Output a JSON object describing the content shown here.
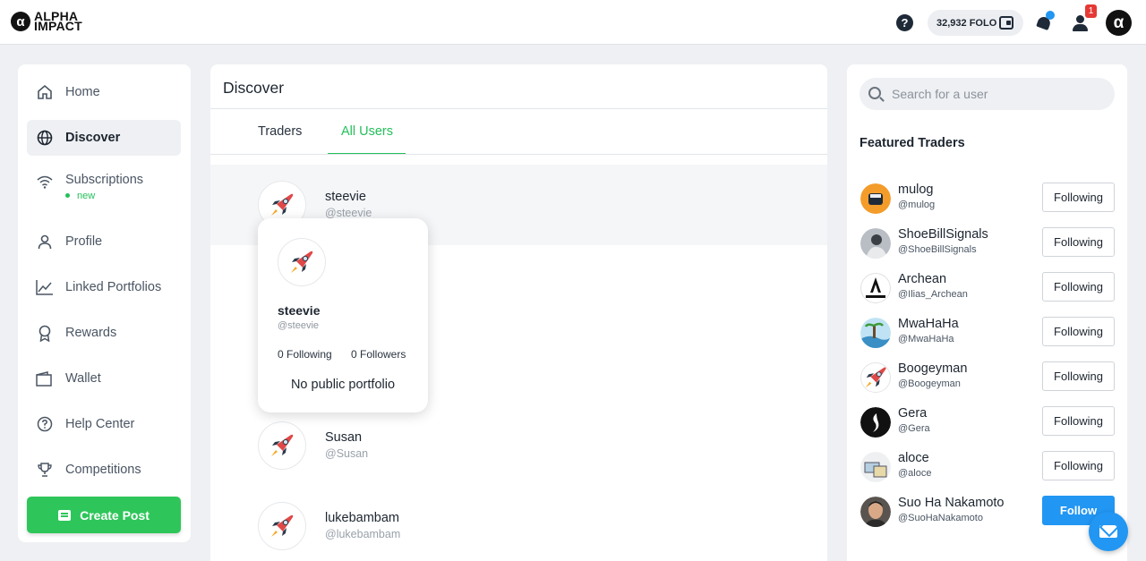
{
  "brand": {
    "name_line1": "ALPHA",
    "name_line2": "IMPACT",
    "mark": "α"
  },
  "header": {
    "help_icon": "question-circle-icon",
    "balance": "32,932 FOLO",
    "notification_badge": "1",
    "account_mark": "α"
  },
  "sidebar": {
    "items": [
      {
        "label": "Home",
        "icon": "home-icon"
      },
      {
        "label": "Discover",
        "icon": "globe-icon",
        "active": true
      },
      {
        "label": "Subscriptions",
        "icon": "wifi-icon",
        "sub": "new"
      },
      {
        "label": "Profile",
        "icon": "person-icon"
      },
      {
        "label": "Linked Portfolios",
        "icon": "chart-icon"
      },
      {
        "label": "Rewards",
        "icon": "award-icon"
      },
      {
        "label": "Wallet",
        "icon": "wallet-icon"
      },
      {
        "label": "Help Center",
        "icon": "help-icon"
      },
      {
        "label": "Competitions",
        "icon": "trophy-icon"
      }
    ],
    "create_post": "Create Post"
  },
  "discover": {
    "title": "Discover",
    "tabs": [
      {
        "label": "Traders"
      },
      {
        "label": "All Users",
        "active": true
      }
    ],
    "users": [
      {
        "name": "steevie",
        "handle": "@steevie"
      },
      {
        "name": "Susan",
        "handle": "@Susan"
      },
      {
        "name": "lukebambam",
        "handle": "@lukebambam"
      }
    ],
    "popover": {
      "name": "steevie",
      "handle": "@steevie",
      "following": "0 Following",
      "followers": "0 Followers",
      "portfolio": "No public portfolio"
    }
  },
  "right": {
    "search_placeholder": "Search for a user",
    "featured_title": "Featured Traders",
    "traders": [
      {
        "name": "mulog",
        "handle": "@mulog",
        "button": "Following",
        "color": "#f39c2a"
      },
      {
        "name": "ShoeBillSignals",
        "handle": "@ShoeBillSignals",
        "button": "Following",
        "color": "#8a8f95"
      },
      {
        "name": "Archean",
        "handle": "@Ilias_Archean",
        "button": "Following",
        "color": "#ffffff"
      },
      {
        "name": "MwaHaHa",
        "handle": "@MwaHaHa",
        "button": "Following",
        "color": "#7fc6e8"
      },
      {
        "name": "Boogeyman",
        "handle": "@Boogeyman",
        "button": "Following",
        "color": "#ffffff"
      },
      {
        "name": "Gera",
        "handle": "@Gera",
        "button": "Following",
        "color": "#111111"
      },
      {
        "name": "aloce",
        "handle": "@aloce",
        "button": "Following",
        "color": "#d9d3b8"
      },
      {
        "name": "Suo Ha Nakamoto",
        "handle": "@SuoHaNakamoto",
        "button": "Follow",
        "color": "#c89a7a"
      }
    ]
  }
}
